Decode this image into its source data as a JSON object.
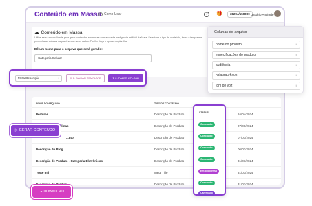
{
  "header": {
    "title": "Conteúdo em Massa",
    "help_label": "Como Usar",
    "credits": "38294/150000",
    "user_name": "Usuário Andrade"
  },
  "intro": {
    "title": "Conteúdo em Massa",
    "description": "Utilize esta funcionalidade para gerar conteúdos em massa com ajuda da inteligência artificial da Mara. Selecione o tipo de conteúdo, baixe o template e preencha as colunas da planilha com seus dados. Por fim, faça o upload da planilha.",
    "name_label": "Dê um nome para o arquivo que será gerado:",
    "name_value": "Categoria Celular"
  },
  "upload": {
    "select_value": "Meta Descrição",
    "download_template_label": "1. BAIXAR TEMPLATE",
    "upload_label": "2. FAZER UPLOAD"
  },
  "columns_panel": {
    "title": "Colunas do arquivo",
    "items": [
      "nome do produto",
      "especificações do produto",
      "audiência",
      "palavra-chave",
      "tom de voz"
    ]
  },
  "table": {
    "headers": {
      "name": "NOME DO ARQUIVO",
      "type": "TIPO DE CONTEÚDO",
      "status": "STATUS"
    },
    "rows": [
      {
        "name": "Perfume",
        "type": "Descrição de Produto",
        "date": "16/04/2024"
      },
      {
        "name": "Bermudas Masculinas",
        "type": "Descrição de Produto",
        "date": "07/06/2024"
      },
      {
        "name": "...uto",
        "type": "Descrição de Produto",
        "date": "07/01/2024"
      },
      {
        "name": "Descrição do Blog",
        "type": "Descrição de Produto",
        "date": "06/02/2024"
      },
      {
        "name": "Descrição de Produto - Categoria Eletrônicos",
        "type": "Descrição de Produto",
        "date": "31/01/2024"
      },
      {
        "name": "Teste mil",
        "type": "Meta Title",
        "date": "31/01/2024"
      },
      {
        "name": "Descrição de Produto",
        "type": "Descrição de Produto",
        "date": "31/01/2024"
      }
    ]
  },
  "status_panel": {
    "header": "STATUS",
    "badges": [
      {
        "label": "Concluído",
        "color": "#2bb673"
      },
      {
        "label": "Concluído",
        "color": "#2bb673"
      },
      {
        "label": "Concluído",
        "color": "#2bb673"
      },
      {
        "label": "Concluído",
        "color": "#2bb673"
      },
      {
        "label": "Em progresso",
        "color": "#b13fd1"
      },
      {
        "label": "Concluído",
        "color": "#2bb673"
      },
      {
        "label": "Carregado",
        "color": "#7a3fd1"
      }
    ]
  },
  "actions": {
    "generate_label": "GERAR CONTEÚDO",
    "download_label": "DOWNLOAD"
  },
  "colors": {
    "accent": "#8a3fd1",
    "pink": "#d63ec2",
    "success": "#2bb673"
  }
}
